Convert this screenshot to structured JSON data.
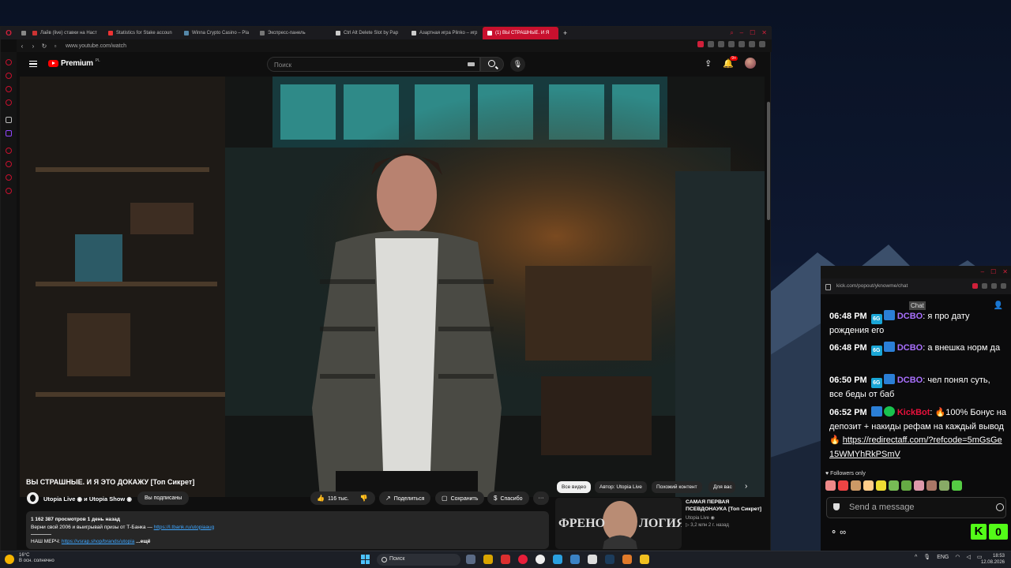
{
  "browser": {
    "tabs": [
      {
        "label": "Лайв (live) ставки на Наст",
        "active": false
      },
      {
        "label": "Statistics for Stake accoun",
        "active": false
      },
      {
        "label": "Winna Crypto Casino – Pla",
        "active": false
      },
      {
        "label": "Экспресс-панель",
        "active": false
      },
      {
        "label": "Ctrl Alt Delete Slot by Pap",
        "active": false
      },
      {
        "label": "Азартная игра Plinko – игр",
        "active": false
      },
      {
        "label": "(1) ВЫ СТРАШНЫЕ. И Я",
        "active": true
      }
    ],
    "new_tab": "+",
    "url": "www.youtube.com/watch",
    "window_controls": [
      "⌕",
      "–",
      "☐",
      "✕"
    ]
  },
  "youtube": {
    "logo_text": "Premium",
    "logo_region": "PL",
    "search_placeholder": "Поиск",
    "notifications_count": "9+",
    "video": {
      "title": "ВЫ СТРАШНЫЕ. И Я ЭТО ДОКАЖУ [Топ Сикрет]",
      "channel": "Utopia Live ◉ и Utopia Show ◉",
      "subscribe_label": "Вы подписаны",
      "likes": "116 тыс.",
      "share_label": "Поделиться",
      "save_label": "Сохранить",
      "thanks_label": "Спасибо",
      "more_label": "···"
    },
    "description": {
      "stats": "1 162 387 просмотров  1 день назад",
      "line1": "Верни свой 2006 и выигрывай призы от Т-Банка —",
      "line1_link": "https://l.tbank.ru/utopiaaug",
      "merch_label": "НАШ МЕРЧ:",
      "merch_link": "https://vsrap.shop/brands/utopia",
      "more": "...ещё"
    },
    "chips": [
      {
        "label": "Все видео",
        "active": true
      },
      {
        "label": "Автор: Utopia Live",
        "active": false
      },
      {
        "label": "Похожий контент",
        "active": false
      },
      {
        "label": "Для вас",
        "active": false
      }
    ],
    "recommended": {
      "thumb_text_left": "ФРЕНО",
      "thumb_text_right": "ЛОГИЯ",
      "title": "САМАЯ ПЕРВАЯ ПСЕВДОНАУКА [Топ Сикрет]",
      "channel": "Utopia Live ◉",
      "meta": "▷ 3,2 млн  2 г. назад"
    }
  },
  "chat_window": {
    "url": "kick.com/popout/yknowme/chat",
    "header": "Chat",
    "window_controls": [
      "–",
      "☐",
      "✕"
    ],
    "messages": [
      {
        "time": "06:48 PM",
        "badges": [
          "6G",
          "pickaxe"
        ],
        "user": "DCBO",
        "user_color": "#a970ff",
        "text": "я про дату рождения его"
      },
      {
        "time": "06:48 PM",
        "badges": [
          "6G",
          "pickaxe"
        ],
        "user": "DCBO",
        "user_color": "#a970ff",
        "text": "а внешка норм да"
      },
      {
        "time": "06:50 PM",
        "badges": [
          "6G",
          "pickaxe"
        ],
        "user": "DCBO",
        "user_color": "#a970ff",
        "text": "чел понял суть, все беды от баб"
      },
      {
        "time": "06:52 PM",
        "badges": [
          "pickaxe",
          "verified"
        ],
        "user": "KickBot",
        "user_color": "#e9113c",
        "text": "🔥100% Бонус на депозит + накиды рефам на каждый вывод 🔥",
        "link": "https://redirectaff.com/?refcode=5mGsGe15WMYhRkPSmV"
      }
    ],
    "followers_label": "Followers only",
    "input_placeholder": "Send a message",
    "points": "∞",
    "kick_count": "0"
  },
  "taskbar": {
    "weather_temp": "16°C",
    "weather_desc": "В осн. солнечно",
    "search_placeholder": "Поиск",
    "lang": "ENG",
    "time": "18:53",
    "date": "12.08.2026"
  }
}
